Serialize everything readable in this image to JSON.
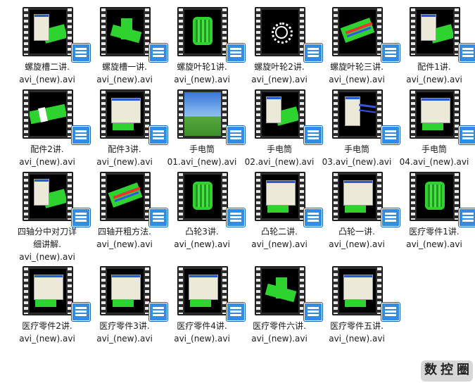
{
  "files": [
    {
      "label": "螺旋槽二讲.\navi_(new).avi",
      "preview": "window-green"
    },
    {
      "label": "螺旋槽一讲.\navi_(new).avi",
      "preview": "green-shape"
    },
    {
      "label": "螺旋叶轮1讲.\navi_(new).avi",
      "preview": "green-gear"
    },
    {
      "label": "螺旋叶轮2讲.\navi_(new).avi",
      "preview": "white-gear"
    },
    {
      "label": "螺旋叶轮三讲.\navi_(new).avi",
      "preview": "green-red"
    },
    {
      "label": "配件1讲.\navi_(new).avi",
      "preview": "window-green"
    },
    {
      "label": "配件2讲.\navi_(new).avi",
      "preview": "green-cylinder"
    },
    {
      "label": "配件3讲.\navi_(new).avi",
      "preview": "dialog"
    },
    {
      "label": "手电筒\n01.avi_(new).avi",
      "preview": "desktop"
    },
    {
      "label": "手电筒\n02.avi_(new).avi",
      "preview": "window-green"
    },
    {
      "label": "手电筒\n03.avi_(new).avi",
      "preview": "window-blue"
    },
    {
      "label": "手电筒\n04.avi_(new).avi",
      "preview": "dialog"
    },
    {
      "label": "四轴分中对刀详\n细讲解.\navi_(new).avi",
      "preview": "window-green"
    },
    {
      "label": "四轴开粗方法.\navi_(new).avi",
      "preview": "green-red"
    },
    {
      "label": "凸轮3讲.\navi_(new).avi",
      "preview": "green-gear"
    },
    {
      "label": "凸轮二讲.\navi_(new).avi",
      "preview": "dialog"
    },
    {
      "label": "凸轮一讲.\navi_(new).avi",
      "preview": "dialog"
    },
    {
      "label": "医疗零件1讲.\navi_(new).avi",
      "preview": "green-gear"
    },
    {
      "label": "医疗零件2讲.\navi_(new).avi",
      "preview": "dialog"
    },
    {
      "label": "医疗零件3讲.\navi_(new).avi",
      "preview": "dialog"
    },
    {
      "label": "医疗零件4讲.\navi_(new).avi",
      "preview": "dialog"
    },
    {
      "label": "医疗零件六讲.\navi_(new).avi",
      "preview": "green-shape"
    },
    {
      "label": "医疗零件五讲.\navi_(new).avi",
      "preview": "dialog"
    }
  ],
  "watermark": {
    "chars": [
      "数",
      "控",
      "圈"
    ]
  },
  "colors": {
    "cad_green": "#2fd32f",
    "overlay_blue": "#2f8de8",
    "film": "#2c2c2c"
  }
}
